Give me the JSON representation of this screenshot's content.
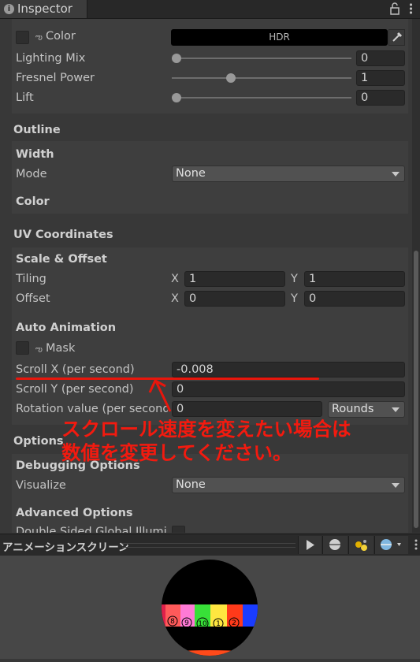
{
  "window": {
    "tab_title": "Inspector"
  },
  "icons": {
    "info": "info-icon",
    "lock": "lock-icon",
    "menu": "kebab-menu-icon",
    "swirl": "link-swirl-icon",
    "eyedropper": "eyedropper-icon",
    "play": "play-icon",
    "sphere": "sphere-icon",
    "lights": "lights-icon",
    "skybox": "skybox-icon"
  },
  "shading": {
    "color_label": "Color",
    "color_value": "HDR",
    "lighting_mix": {
      "label": "Lighting Mix",
      "value": "0",
      "fraction": 0
    },
    "fresnel_power": {
      "label": "Fresnel Power",
      "value": "1",
      "fraction": 0.3
    },
    "lift": {
      "label": "Lift",
      "value": "0",
      "fraction": 0
    }
  },
  "outline": {
    "header": "Outline",
    "width_label": "Width",
    "mode_label": "Mode",
    "mode_value": "None",
    "color_label": "Color"
  },
  "uv": {
    "header": "UV Coordinates",
    "scale_offset_header": "Scale & Offset",
    "tiling_label": "Tiling",
    "offset_label": "Offset",
    "x_label": "X",
    "y_label": "Y",
    "tiling_x": "1",
    "tiling_y": "1",
    "offset_x": "0",
    "offset_y": "0",
    "auto_anim_header": "Auto Animation",
    "mask_label": "Mask",
    "scroll_x_label": "Scroll X (per second)",
    "scroll_x_value": "-0.008",
    "scroll_y_label": "Scroll Y (per second)",
    "scroll_y_value": "0",
    "rotation_label": "Rotation value (per second)",
    "rotation_value": "0",
    "rotation_mode": "Rounds"
  },
  "options": {
    "header": "Options",
    "debug_header": "Debugging Options",
    "visualize_label": "Visualize",
    "visualize_value": "None",
    "advanced_header": "Advanced Options",
    "double_sided_label": "Double Sided Global Illumination"
  },
  "annotation": {
    "line1": "スクロール速度を変えたい場合は",
    "line2": "数値を変更してください。",
    "color": "#f31a0f"
  },
  "animation_panel": {
    "title": "アニメーションスクリーン",
    "ball_numbers": [
      "8",
      "9",
      "10",
      "1",
      "2"
    ]
  },
  "colors": {
    "bg": "#383838",
    "field_bg": "#2a2a2a",
    "accent_red": "#e8160c"
  }
}
